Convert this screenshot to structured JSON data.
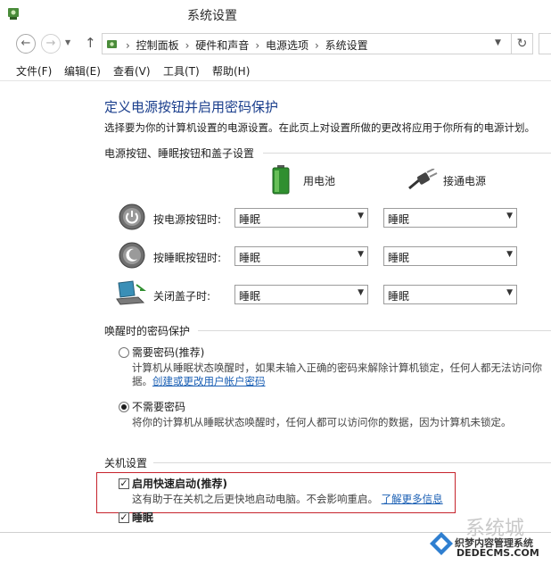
{
  "window": {
    "title": "系统设置"
  },
  "nav": {
    "breadcrumbs": [
      "控制面板",
      "硬件和声音",
      "电源选项",
      "系统设置"
    ]
  },
  "menu": [
    "文件(F)",
    "编辑(E)",
    "查看(V)",
    "工具(T)",
    "帮助(H)"
  ],
  "page": {
    "title": "定义电源按钮并启用密码保护",
    "description": "选择要为你的计算机设置的电源设置。在此页上对设置所做的更改将应用于你所有的电源计划。"
  },
  "power_section": {
    "heading": "电源按钮、睡眠按钮和盖子设置",
    "battery_label": "用电池",
    "plugged_label": "接通电源",
    "rows": [
      {
        "label": "按电源按钮时:",
        "battery": "睡眠",
        "plugged": "睡眠"
      },
      {
        "label": "按睡眠按钮时:",
        "battery": "睡眠",
        "plugged": "睡眠"
      },
      {
        "label": "关闭盖子时:",
        "battery": "睡眠",
        "plugged": "睡眠"
      }
    ]
  },
  "wake_section": {
    "heading": "唤醒时的密码保护",
    "require": {
      "label": "需要密码(推荐)",
      "desc1": "计算机从睡眠状态唤醒时，如果未输入正确的密码来解除计算机锁定，任何人都无法访问你",
      "desc2_prefix": "据。",
      "link": "创建或更改用户帐户密码",
      "selected": false
    },
    "no_require": {
      "label": "不需要密码",
      "desc": "将你的计算机从睡眠状态唤醒时，任何人都可以访问你的数据，因为计算机未锁定。",
      "selected": true
    }
  },
  "shutdown_section": {
    "heading": "关机设置",
    "fast_startup": {
      "label": "启用快速启动(推荐)",
      "desc": "这有助于在关机之后更快地启动电脑。不会影响重启。",
      "link": "了解更多信息",
      "checked": true
    },
    "sleep": {
      "label": "睡眠",
      "checked": true
    }
  },
  "watermark": {
    "brand": "系统城",
    "line1": "织梦内容管理系统",
    "line2": "DEDECMS.COM"
  },
  "colors": {
    "title_blue": "#1a3e8c",
    "link_blue": "#1a5fb4",
    "highlight_red": "#c6232c"
  }
}
